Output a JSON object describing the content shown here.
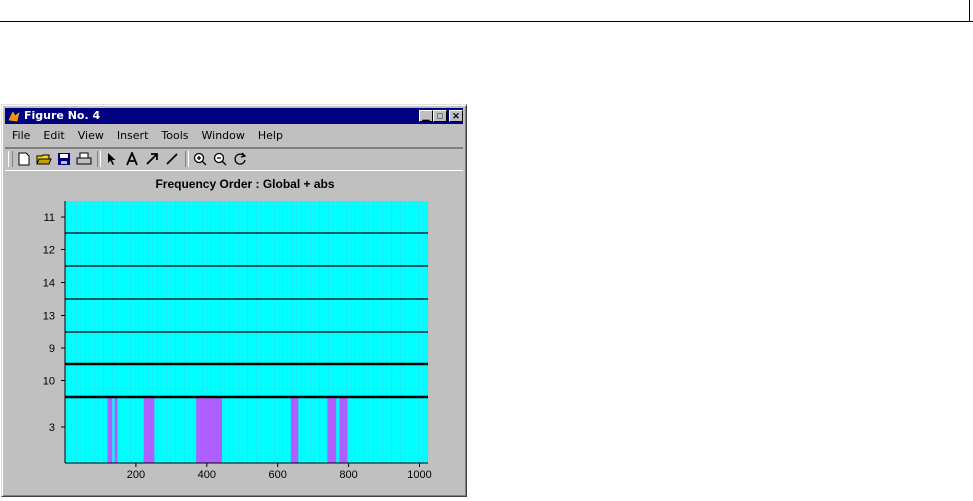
{
  "window": {
    "title": "Figure No. 4",
    "controls": [
      "minimize",
      "maximize",
      "close"
    ]
  },
  "menu": [
    "File",
    "Edit",
    "View",
    "Insert",
    "Tools",
    "Window",
    "Help"
  ],
  "toolbar": [
    "new-file-icon",
    "open-folder-icon",
    "save-icon",
    "print-icon",
    "arrow-pointer-icon",
    "text-a-icon",
    "arrow-icon",
    "line-icon",
    "zoom-in-icon",
    "zoom-out-icon",
    "rotate-icon"
  ],
  "chart_data": {
    "type": "heatmap",
    "title": "Frequency Order : Global + abs",
    "xlim": [
      0,
      1024
    ],
    "xticks": [
      200,
      400,
      600,
      800,
      1000
    ],
    "rows": [
      "11",
      "12",
      "14",
      "13",
      "9",
      "10",
      "3"
    ],
    "colors": {
      "base": "#00ffff",
      "hot": "#cc44ff"
    },
    "bands": [
      {
        "row": "3",
        "x": [
          120,
          133
        ]
      },
      {
        "row": "3",
        "x": [
          140,
          148
        ]
      },
      {
        "row": "3",
        "x": [
          222,
          252
        ]
      },
      {
        "row": "3",
        "x": [
          370,
          443
        ]
      },
      {
        "row": "3",
        "x": [
          637,
          658
        ]
      },
      {
        "row": "3",
        "x": [
          740,
          765
        ]
      },
      {
        "row": "3",
        "x": [
          774,
          797
        ]
      }
    ]
  }
}
